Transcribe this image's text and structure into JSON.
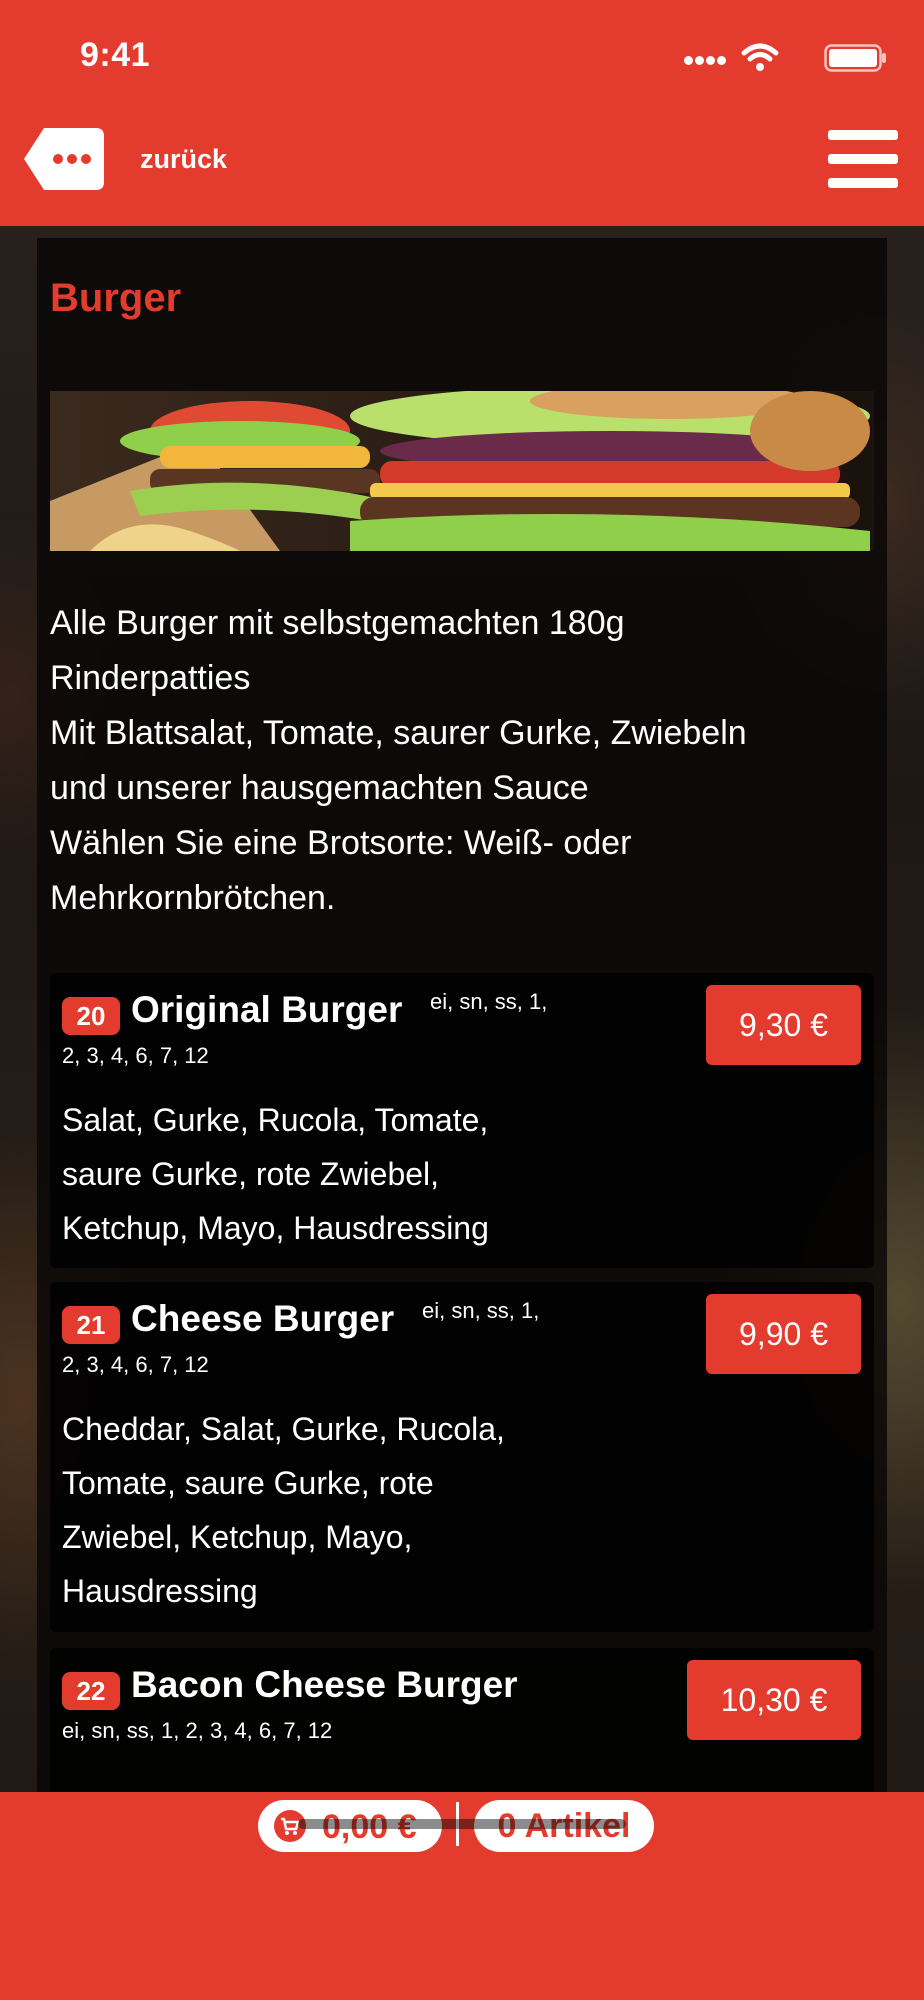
{
  "status_bar": {
    "time": "9:41"
  },
  "header": {
    "back_label": "zurück"
  },
  "section": {
    "title": "Burger",
    "description_lines": [
      "Alle Burger mit selbstgemachten 180g",
      "Rinderpatties",
      "Mit Blattsalat, Tomate, saurer Gurke, Zwiebeln",
      "und unserer hausgemachten Sauce",
      "Wählen Sie eine Brotsorte: Weiß- oder",
      "Mehrkornbrötchen."
    ]
  },
  "items": [
    {
      "number": "20",
      "name": "Original Burger",
      "allergens_line1": "ei, sn, ss, 1,",
      "allergens_line2": "2, 3, 4, 6, 7, 12",
      "description_lines": [
        "Salat, Gurke, Rucola, Tomate,",
        "saure Gurke, rote Zwiebel,",
        "Ketchup, Mayo, Hausdressing"
      ],
      "price": "9,30 €"
    },
    {
      "number": "21",
      "name": "Cheese Burger",
      "allergens_line1": "ei, sn, ss, 1,",
      "allergens_line2": "2, 3, 4, 6, 7, 12",
      "description_lines": [
        "Cheddar, Salat, Gurke, Rucola,",
        "Tomate, saure Gurke, rote",
        "Zwiebel, Ketchup, Mayo,",
        "Hausdressing"
      ],
      "price": "9,90 €"
    },
    {
      "number": "22",
      "name": "Bacon Cheese Burger",
      "allergens_line1": "",
      "allergens_line2": "ei, sn, ss, 1, 2, 3, 4, 6, 7, 12",
      "description_lines": [],
      "price": "10,30 €"
    }
  ],
  "cart": {
    "total": "0,00 €",
    "separator": "|",
    "articles": "0 Artikel"
  },
  "colors": {
    "accent": "#e33b2e",
    "text": "#ffffff",
    "panel": "#0a0808"
  },
  "icons": {
    "back": "ellipsis-tag-icon",
    "menu": "hamburger-menu-icon",
    "cart": "shopping-cart-icon"
  }
}
